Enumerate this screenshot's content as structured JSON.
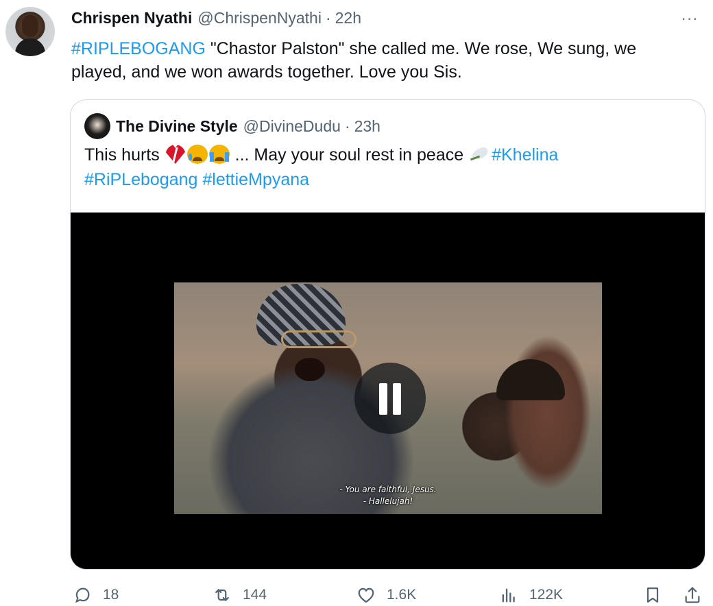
{
  "tweet": {
    "author_name": "Chrispen Nyathi",
    "author_handle": "@ChrispenNyathi",
    "separator": "·",
    "time": "22h",
    "more_label": "···",
    "hashtag": "#RIPLEBOGANG",
    "text_line_1": " \"Chastor Palston\" she called me. We rose, We sung, we",
    "text_line_2": "played, and we won awards together. Love you Sis."
  },
  "quote": {
    "author_name": "The Divine Style",
    "author_handle": "@DivineDudu",
    "separator": "·",
    "time": "23h",
    "text_start": "This hurts ",
    "text_middle": " ... May your soul rest in peace ",
    "hashtag_1": "#Khelina",
    "hashtag_2": "#RiPLebogang",
    "hashtag_3": "#lettieMpyana",
    "emojis": [
      "broken-heart",
      "crying-face",
      "loudly-crying-face",
      "dove"
    ],
    "video": {
      "state": "playing",
      "subtitle_line_1": "- You are faithful, Jesus.",
      "subtitle_line_2": "- Hallelujah!"
    }
  },
  "actions": {
    "reply_count": "18",
    "retweet_count": "144",
    "like_count": "1.6K",
    "views_count": "122K"
  },
  "colors": {
    "accent": "#1d9bf0",
    "secondary_text": "#536471",
    "border": "#cfd9de"
  }
}
